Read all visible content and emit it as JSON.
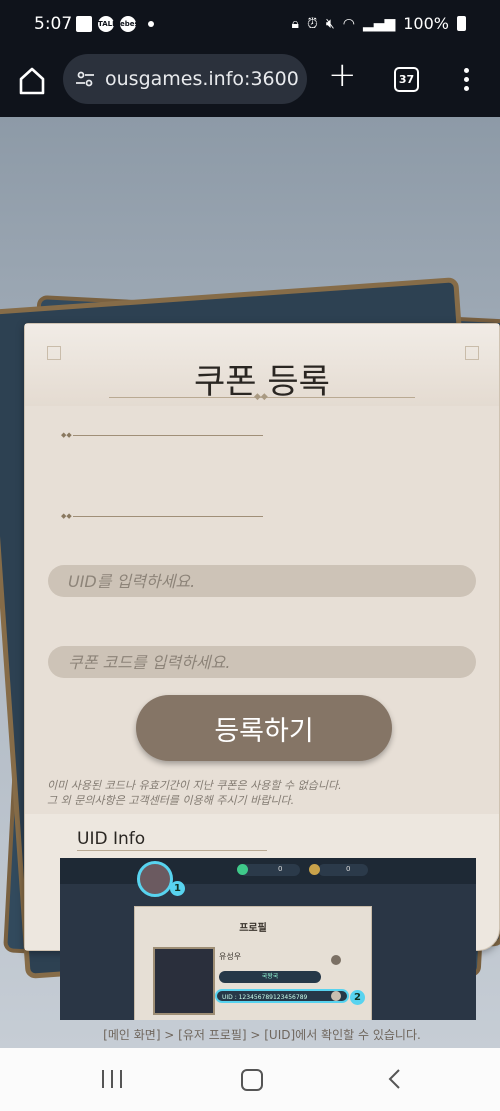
{
  "status_bar": {
    "time": "5:07",
    "notif_icons": [
      "image-icon",
      "talk-icon",
      "game-icon"
    ],
    "notif_talk": "TALK",
    "notif_game": "ebes",
    "battery": "100%"
  },
  "browser": {
    "url": "ousgames.info:3600",
    "tab_count": "37"
  },
  "coupon": {
    "title": "쿠폰 등록",
    "uid_placeholder": "UID를 입력하세요.",
    "code_placeholder": "쿠폰 코드를 입력하세요.",
    "submit_label": "등록하기",
    "notice_line1": "이미 사용된 코드나 유효기간이 지난 쿠폰은 사용할 수 없습니다.",
    "notice_line2": "그 외 문의사항은 고객센터를 이용해 주시기 바랍니다."
  },
  "uid_info": {
    "heading": "UID Info",
    "profile_title": "프로필",
    "profile_name": "유성우",
    "profile_status": "국왕국",
    "uid_text": "UID : 1234567891234567​89",
    "badge_1": "1",
    "badge_2": "2",
    "top_value_1": "0",
    "top_value_2": "0",
    "caption": "[메인 화면] > [유저 프로필] > [UID]에서 확인할 수 있습니다."
  },
  "colors": {
    "accent_cyan": "#58d3ef",
    "button_brown": "#857566",
    "card_beige": "#e7dfd6"
  }
}
